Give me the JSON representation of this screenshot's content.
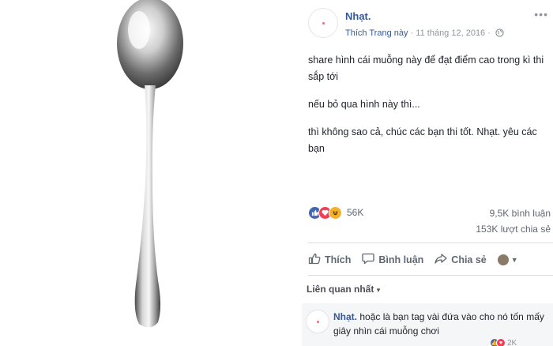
{
  "post": {
    "page_name": "Nhạt.",
    "like_page": "Thích Trang này",
    "separator": "·",
    "date": "11 tháng 12, 2016",
    "date_separator": "·",
    "more_icon": "more-dots-icon",
    "privacy_icon": "globe-icon",
    "text_line1": "share hình cái muỗng này để đạt điểm cao trong kì thi sắp tới",
    "text_line2": "nếu bỏ qua hình này thì...",
    "text_line3": "thì không sao cả, chúc các bạn thi tốt. Nhạt. yêu các bạn"
  },
  "stats": {
    "reaction_icons": [
      "like-reaction-icon",
      "love-reaction-icon",
      "haha-reaction-icon"
    ],
    "reactions": "56K",
    "comments": "9,5K bình luận",
    "shares": "153K lượt chia sẻ"
  },
  "actions": {
    "like": "Thích",
    "comment": "Bình luận",
    "share": "Chia sẻ"
  },
  "comments": {
    "sort_label": "Liên quan nhất",
    "sort_arrow": "▾",
    "first": {
      "author": "Nhạt.",
      "text": "hoặc là bạn tag vài đứa vào cho nó tốn mấy giây nhìn cái muỗng chơi",
      "reactions": "2K"
    }
  },
  "colors": {
    "link": "#385898",
    "muted": "#90949c",
    "like_blue": "#4267b2",
    "love_red": "#f33e58",
    "haha_yellow": "#f7b125"
  }
}
